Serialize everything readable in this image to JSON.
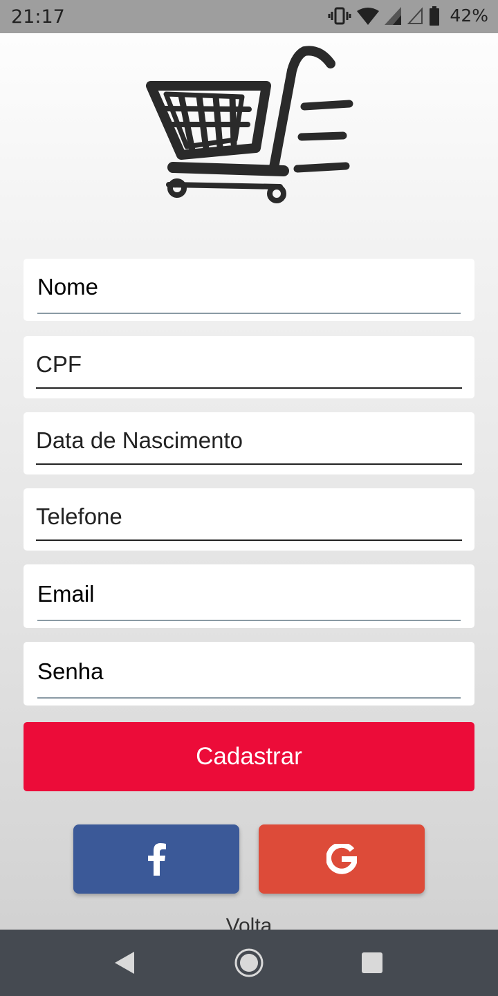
{
  "status_bar": {
    "time": "21:17",
    "battery_percent": "42%",
    "icons": [
      "vibrate-icon",
      "wifi-icon",
      "signal-icon",
      "signal-empty-icon",
      "battery-icon"
    ]
  },
  "logo": {
    "icon": "shopping-cart-icon"
  },
  "form": {
    "nome_label": "Nome",
    "cpf_label": "CPF",
    "nascimento_label": "Data de Nascimento",
    "telefone_label": "Telefone",
    "email_label": "Email",
    "senha_label": "Senha"
  },
  "actions": {
    "cadastrar_label": "Cadastrar",
    "facebook_icon": "facebook-icon",
    "google_icon": "google-icon",
    "volta_label": "Volta"
  },
  "colors": {
    "primary": "#ec0c39",
    "facebook": "#3b5998",
    "google": "#dd4b39",
    "navbar": "#454a51"
  },
  "nav": [
    "back-icon",
    "home-icon",
    "recents-icon"
  ]
}
